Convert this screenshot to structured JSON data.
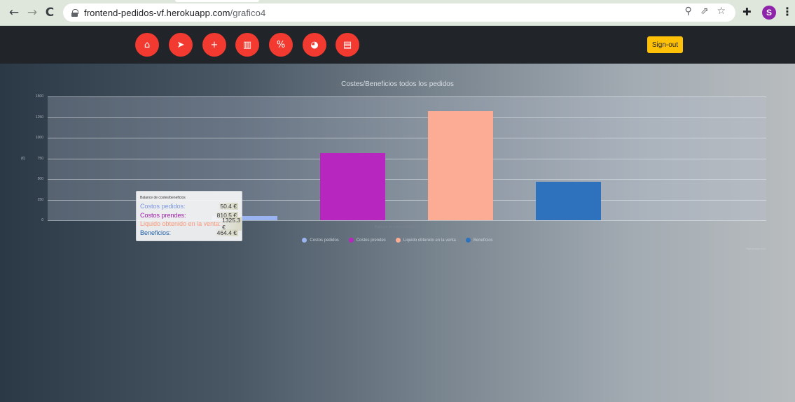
{
  "browser": {
    "url_host": "frontend-pedidos-vf.herokuapp.com",
    "url_path": "/grafico4",
    "profile_initial": "S",
    "icons": [
      "back-arrow-icon",
      "forward-arrow-icon",
      "reload-icon",
      "lock-icon",
      "zoom-icon",
      "share-icon",
      "star-icon",
      "extensions-icon",
      "menu-dots-icon"
    ]
  },
  "nav": {
    "buttons": [
      {
        "name": "home",
        "glyph": "⌂"
      },
      {
        "name": "send",
        "glyph": "➤"
      },
      {
        "name": "add-user",
        "glyph": "+"
      },
      {
        "name": "bar-chart",
        "glyph": "▥"
      },
      {
        "name": "percent",
        "glyph": "%"
      },
      {
        "name": "pie-chart",
        "glyph": "◕"
      },
      {
        "name": "area-chart",
        "glyph": "▤"
      }
    ],
    "signout_label": "Sign-out",
    "accent_color": "#f23a30",
    "signout_color": "#ffc107"
  },
  "chart_data": {
    "type": "bar",
    "title": "Costes/Beneficios todos los pedidos",
    "xlabel": "Balance de costes/beneficios",
    "ylabel": "(€)",
    "ylim": [
      0,
      1500
    ],
    "yticks": [
      0,
      250,
      500,
      750,
      1000,
      1250,
      1500
    ],
    "series": [
      {
        "name": "Costos pedidos",
        "value": 50.4,
        "color": "#99b4f0"
      },
      {
        "name": "Costos prendes",
        "value": 810.5,
        "color": "#b727bf"
      },
      {
        "name": "Liquido obtenido en la venta",
        "value": 1325.3,
        "color": "#fcac94"
      },
      {
        "name": "Beneficios",
        "value": 464.4,
        "color": "#2e72be"
      }
    ],
    "credit": "Highcharts.com",
    "tooltip": {
      "header": "Balance de costes/beneficios",
      "rows": [
        {
          "label": "Costos pedidos:",
          "value": "50.4 €",
          "color": "#7c97e4"
        },
        {
          "label": "Costos prendes:",
          "value": "810.5 €",
          "color": "#9c1aa6"
        },
        {
          "label": "Liquido obtenido en la venta:",
          "value": "1325.3 €",
          "color": "#f7997a"
        },
        {
          "label": "Beneficios:",
          "value": "464.4 €",
          "color": "#1f5fa8"
        }
      ]
    }
  }
}
